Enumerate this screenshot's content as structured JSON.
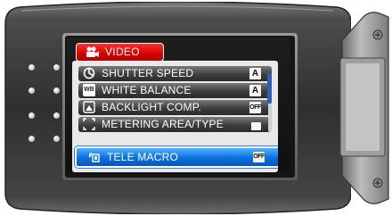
{
  "menu": {
    "title": "VIDEO",
    "title_icon": "video-camera-icon",
    "items": [
      {
        "label": "SHUTTER SPEED",
        "icon": "shutter-icon",
        "value": "A"
      },
      {
        "label": "WHITE BALANCE",
        "icon": "wb-icon",
        "value": "A"
      },
      {
        "label": "BACKLIGHT COMP.",
        "icon": "backlight-icon",
        "value": "OFF"
      },
      {
        "label": "METERING AREA/TYPE",
        "icon": "metering-icon",
        "value": ""
      }
    ],
    "selected": {
      "label": "TELE MACRO",
      "icon": "tele-macro-icon",
      "value": "OFF"
    },
    "wb_icon_text": "WB"
  },
  "colors": {
    "accent": "#d60000",
    "selection": "#0a6fe0",
    "body": "#3c3c3c"
  }
}
